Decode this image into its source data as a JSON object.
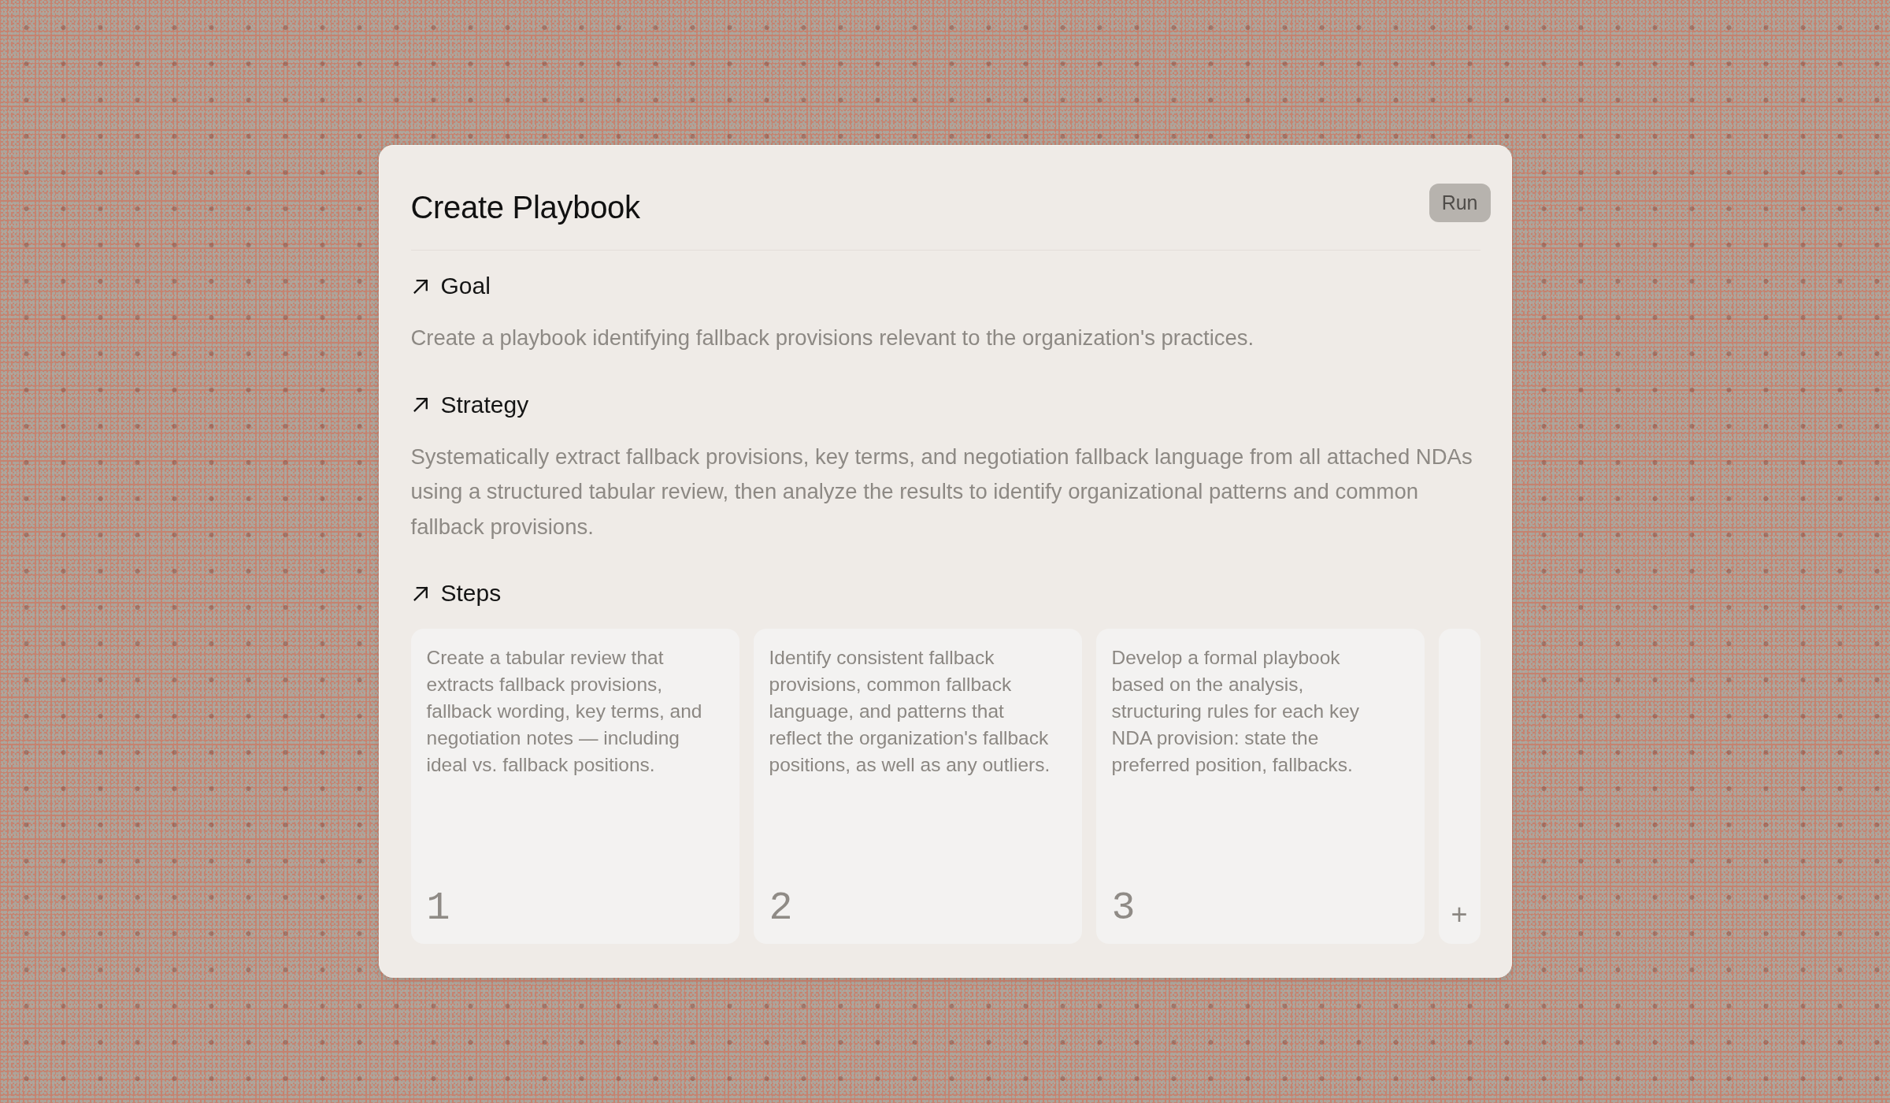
{
  "dialog": {
    "title": "Create Playbook",
    "run_button": "Run"
  },
  "sections": [
    {
      "kind": "text",
      "heading": "Goal",
      "body": "Create a playbook identifying fallback provisions relevant to the organization's practices."
    },
    {
      "kind": "text",
      "heading": "Strategy",
      "body": "Systematically extract fallback provisions, key terms, and negotiation fallback language from all attached NDAs using a structured tabular review, then analyze the results to identify organizational patterns and common fallback provisions."
    },
    {
      "kind": "steps",
      "heading": "Steps",
      "steps": [
        {
          "text": "Create a tabular review that extracts fallback provisions, fallback wording, key terms, and negotiation notes — including ideal vs. fallback positions.",
          "number": "1"
        },
        {
          "text": "Identify consistent fallback provisions, common fallback language, and patterns that reflect the organization's fallback positions, as well as any outliers.",
          "number": "2"
        },
        {
          "text": "Develop a formal playbook based on the analysis, structuring rules for each key NDA provision: state the preferred position, fallbacks.",
          "number": "3"
        }
      ],
      "add_button": "+"
    }
  ]
}
